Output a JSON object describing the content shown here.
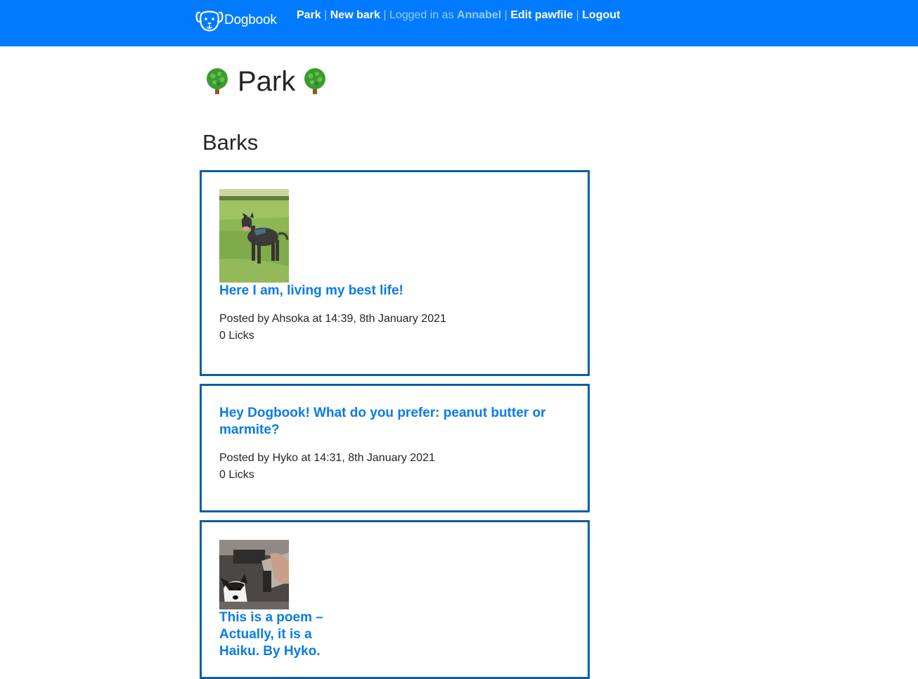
{
  "nav": {
    "brand": "Dogbook",
    "park": "Park",
    "sep1": " | ",
    "new_bark": "New bark",
    "sep2": " | ",
    "logged_in_prefix": "Logged in as ",
    "username": "Annabel",
    "sep3": " | ",
    "edit_pawfile": "Edit pawfile",
    "sep4": " | ",
    "logout": "Logout"
  },
  "page": {
    "title": "Park",
    "title_icon": "tree-emoji",
    "section_title": "Barks"
  },
  "barks": [
    {
      "title": "Here I am, living my best life!",
      "posted": "Posted by Ahsoka at 14:39, 8th January 2021",
      "licks": "0 Licks",
      "image": "dog-on-grass-photo"
    },
    {
      "title": "Hey Dogbook! What do you prefer: peanut butter or marmite?",
      "posted": "Posted by Hyko at 14:31, 8th January 2021",
      "licks": "0 Licks"
    },
    {
      "title": "This is a poem – Actually, it is a Haiku. By Hyko.",
      "image": "husky-in-car-photo"
    }
  ],
  "colors": {
    "navbar": "#007bff",
    "link": "#0a7be8",
    "card_border": "#0b5fa5"
  }
}
